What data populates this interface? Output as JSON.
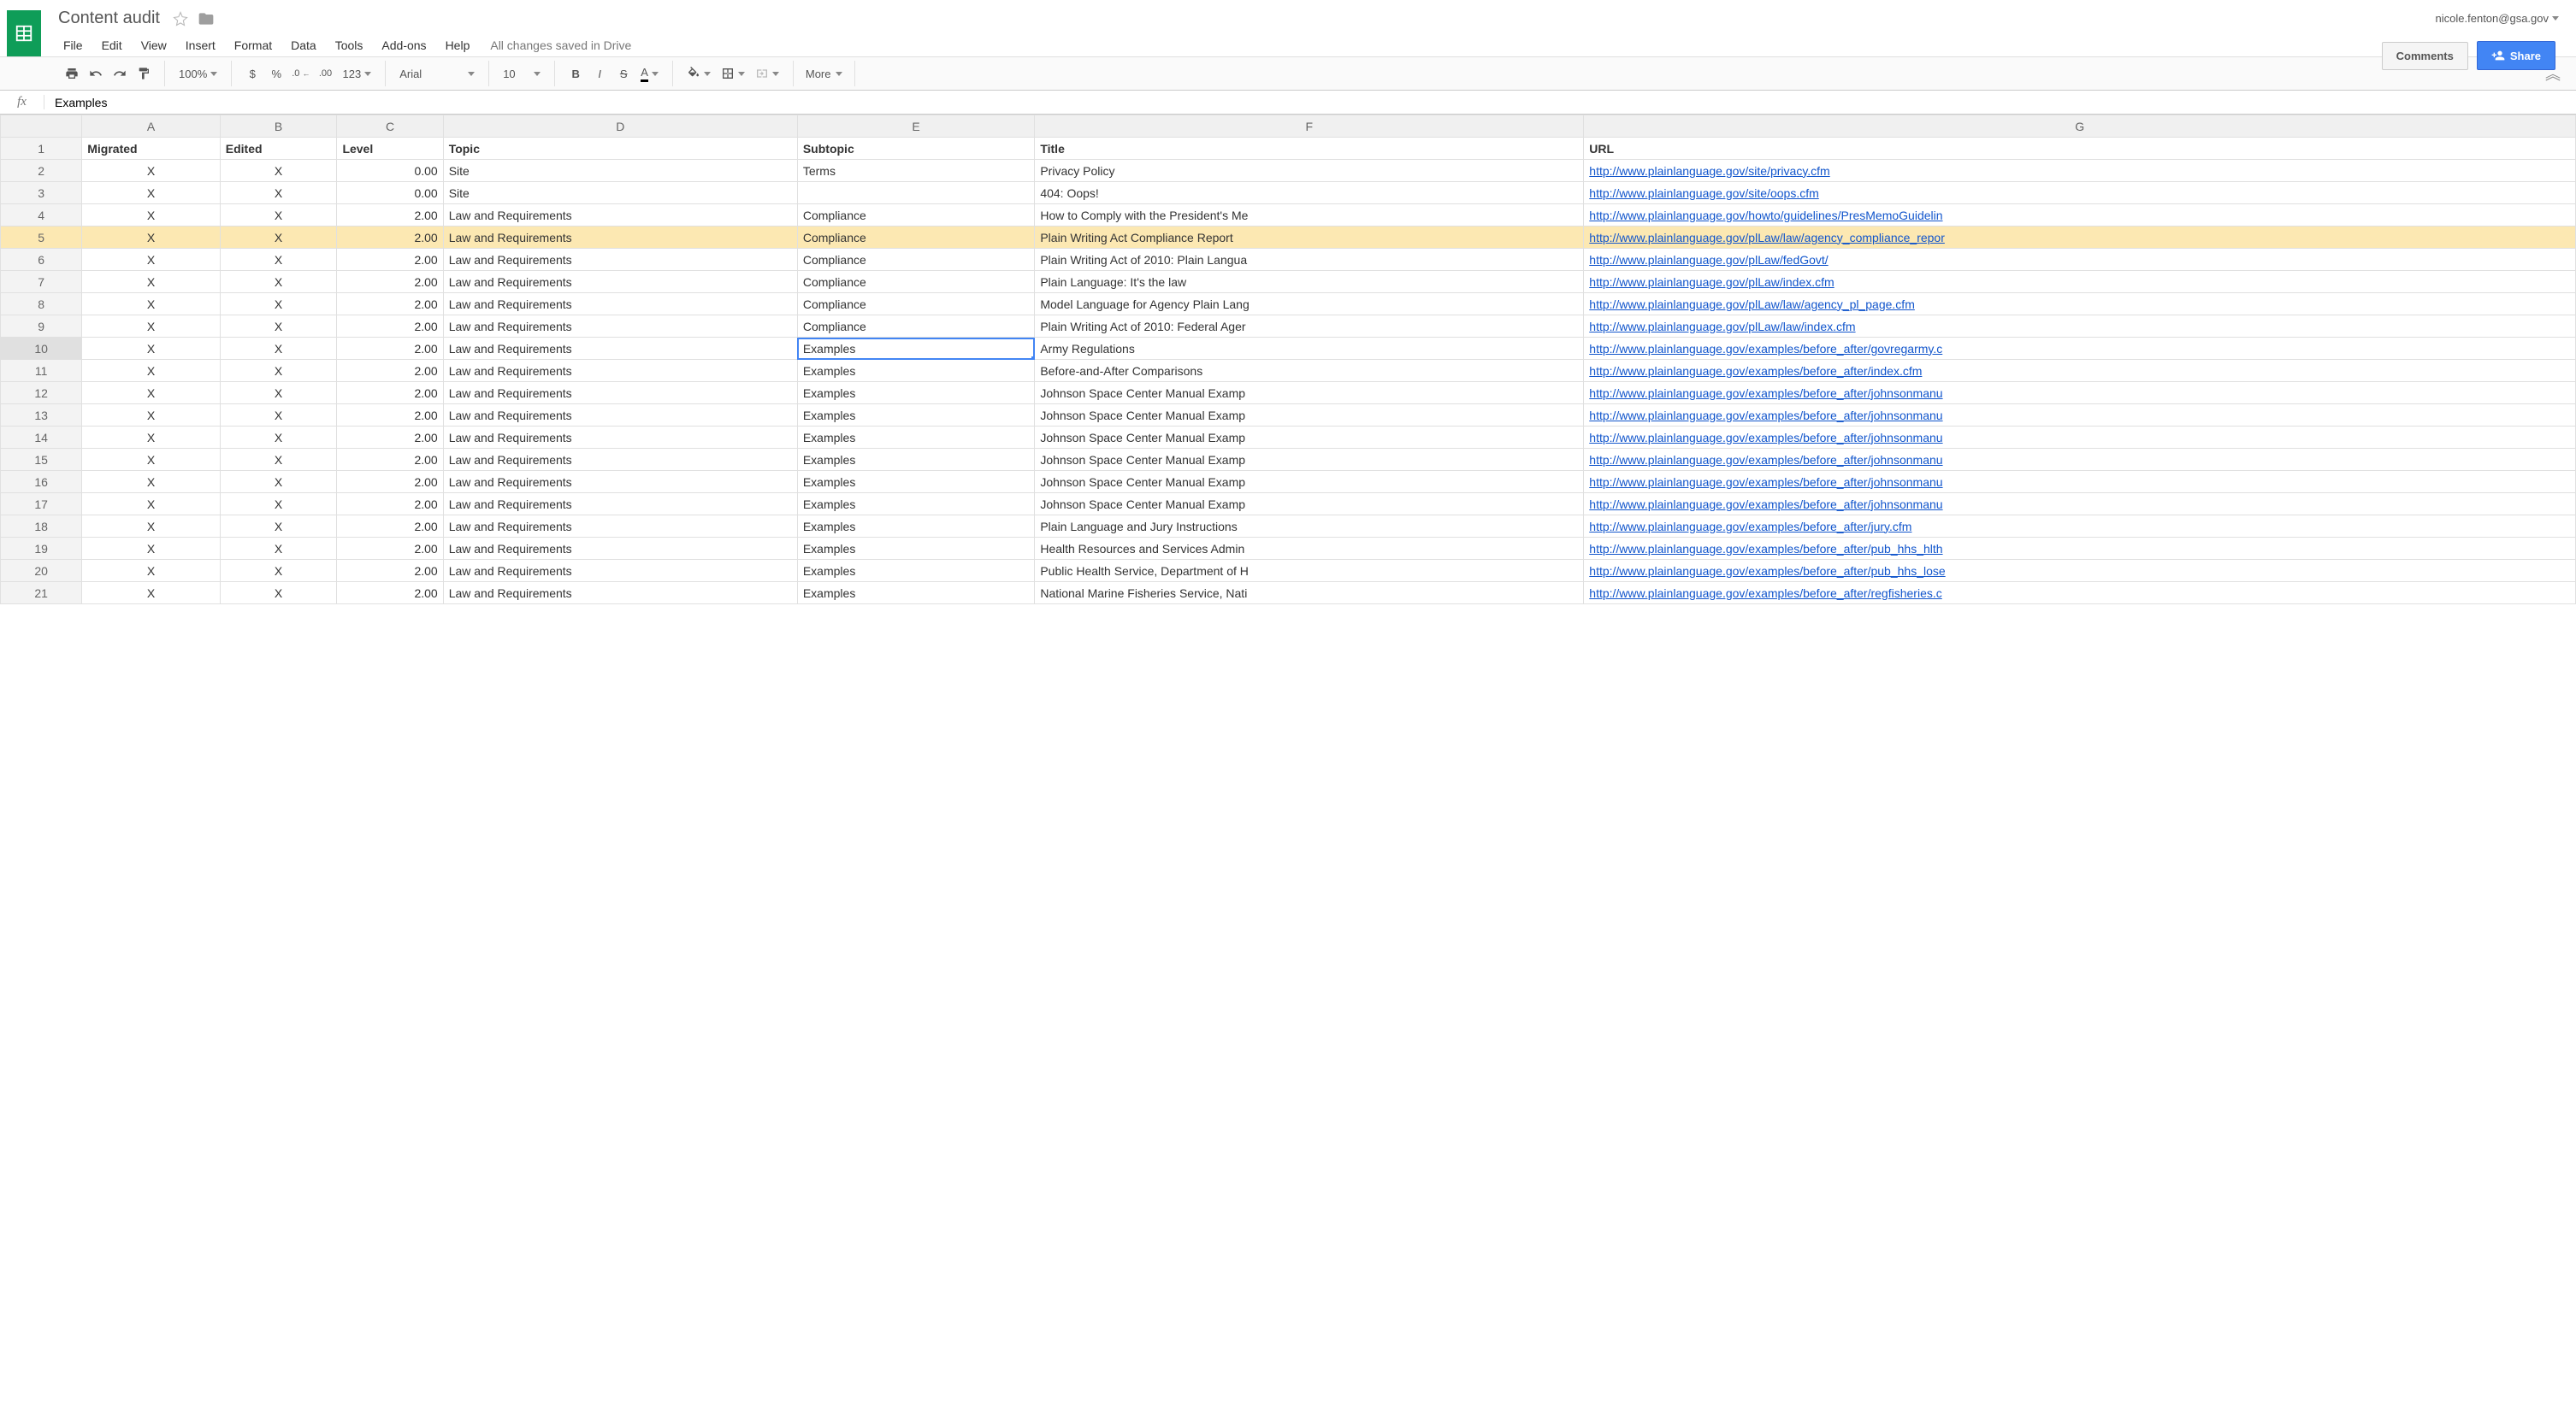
{
  "user_email": "nicole.fenton@gsa.gov",
  "doc_title": "Content audit",
  "save_status": "All changes saved in Drive",
  "menubar": [
    "File",
    "Edit",
    "View",
    "Insert",
    "Format",
    "Data",
    "Tools",
    "Add-ons",
    "Help"
  ],
  "buttons": {
    "comments": "Comments",
    "share": "Share"
  },
  "toolbar": {
    "zoom": "100%",
    "currency": "$",
    "percent": "%",
    "dec_dec": ".0",
    "inc_dec": ".00",
    "numfmt": "123",
    "font": "Arial",
    "font_size": "10",
    "more": "More"
  },
  "formula_cell_value": "Examples",
  "column_letters": [
    "A",
    "B",
    "C",
    "D",
    "E",
    "F",
    "G"
  ],
  "column_headers": [
    "Migrated",
    "Edited",
    "Level",
    "Topic",
    "Subtopic",
    "Title",
    "URL"
  ],
  "selected_cell": {
    "row": 10,
    "col": "E"
  },
  "highlight_row": 5,
  "rows": [
    {
      "n": 2,
      "migrated": "X",
      "edited": "X",
      "level": "0.00",
      "topic": "Site",
      "subtopic": "Terms",
      "title": "Privacy Policy",
      "url": "http://www.plainlanguage.gov/site/privacy.cfm"
    },
    {
      "n": 3,
      "migrated": "X",
      "edited": "X",
      "level": "0.00",
      "topic": "Site",
      "subtopic": "",
      "title": "404: Oops!",
      "url": "http://www.plainlanguage.gov/site/oops.cfm"
    },
    {
      "n": 4,
      "migrated": "X",
      "edited": "X",
      "level": "2.00",
      "topic": "Law and Requirements",
      "subtopic": "Compliance",
      "title": "How to Comply with the President's Me",
      "url": "http://www.plainlanguage.gov/howto/guidelines/PresMemoGuidelin"
    },
    {
      "n": 5,
      "migrated": "X",
      "edited": "X",
      "level": "2.00",
      "topic": "Law and Requirements",
      "subtopic": "Compliance",
      "title": "Plain Writing Act Compliance Report",
      "url": "http://www.plainlanguage.gov/plLaw/law/agency_compliance_repor"
    },
    {
      "n": 6,
      "migrated": "X",
      "edited": "X",
      "level": "2.00",
      "topic": "Law and Requirements",
      "subtopic": "Compliance",
      "title": "Plain Writing Act of 2010: Plain Langua",
      "url": "http://www.plainlanguage.gov/plLaw/fedGovt/"
    },
    {
      "n": 7,
      "migrated": "X",
      "edited": "X",
      "level": "2.00",
      "topic": "Law and Requirements",
      "subtopic": "Compliance",
      "title": "Plain Language: It's the law",
      "url": "http://www.plainlanguage.gov/plLaw/index.cfm"
    },
    {
      "n": 8,
      "migrated": "X",
      "edited": "X",
      "level": "2.00",
      "topic": "Law and Requirements",
      "subtopic": "Compliance",
      "title": "Model Language for Agency Plain Lang",
      "url": "http://www.plainlanguage.gov/plLaw/law/agency_pl_page.cfm"
    },
    {
      "n": 9,
      "migrated": "X",
      "edited": "X",
      "level": "2.00",
      "topic": "Law and Requirements",
      "subtopic": "Compliance",
      "title": "Plain Writing Act of 2010: Federal Ager",
      "url": "http://www.plainlanguage.gov/plLaw/law/index.cfm"
    },
    {
      "n": 10,
      "migrated": "X",
      "edited": "X",
      "level": "2.00",
      "topic": "Law and Requirements",
      "subtopic": "Examples",
      "title": "Army Regulations",
      "url": "http://www.plainlanguage.gov/examples/before_after/govregarmy.c"
    },
    {
      "n": 11,
      "migrated": "X",
      "edited": "X",
      "level": "2.00",
      "topic": "Law and Requirements",
      "subtopic": "Examples",
      "title": "Before-and-After Comparisons",
      "url": "http://www.plainlanguage.gov/examples/before_after/index.cfm"
    },
    {
      "n": 12,
      "migrated": "X",
      "edited": "X",
      "level": "2.00",
      "topic": "Law and Requirements",
      "subtopic": "Examples",
      "title": "Johnson Space Center Manual Examp",
      "url": "http://www.plainlanguage.gov/examples/before_after/johnsonmanu"
    },
    {
      "n": 13,
      "migrated": "X",
      "edited": "X",
      "level": "2.00",
      "topic": "Law and Requirements",
      "subtopic": "Examples",
      "title": "Johnson Space Center Manual Examp",
      "url": "http://www.plainlanguage.gov/examples/before_after/johnsonmanu"
    },
    {
      "n": 14,
      "migrated": "X",
      "edited": "X",
      "level": "2.00",
      "topic": "Law and Requirements",
      "subtopic": "Examples",
      "title": "Johnson Space Center Manual Examp",
      "url": "http://www.plainlanguage.gov/examples/before_after/johnsonmanu"
    },
    {
      "n": 15,
      "migrated": "X",
      "edited": "X",
      "level": "2.00",
      "topic": "Law and Requirements",
      "subtopic": "Examples",
      "title": "Johnson Space Center Manual Examp",
      "url": "http://www.plainlanguage.gov/examples/before_after/johnsonmanu"
    },
    {
      "n": 16,
      "migrated": "X",
      "edited": "X",
      "level": "2.00",
      "topic": "Law and Requirements",
      "subtopic": "Examples",
      "title": "Johnson Space Center Manual Examp",
      "url": "http://www.plainlanguage.gov/examples/before_after/johnsonmanu"
    },
    {
      "n": 17,
      "migrated": "X",
      "edited": "X",
      "level": "2.00",
      "topic": "Law and Requirements",
      "subtopic": "Examples",
      "title": "Johnson Space Center Manual Examp",
      "url": "http://www.plainlanguage.gov/examples/before_after/johnsonmanu"
    },
    {
      "n": 18,
      "migrated": "X",
      "edited": "X",
      "level": "2.00",
      "topic": "Law and Requirements",
      "subtopic": "Examples",
      "title": "Plain Language and Jury Instructions",
      "url": "http://www.plainlanguage.gov/examples/before_after/jury.cfm"
    },
    {
      "n": 19,
      "migrated": "X",
      "edited": "X",
      "level": "2.00",
      "topic": "Law and Requirements",
      "subtopic": "Examples",
      "title": "Health Resources and Services Admin",
      "url": "http://www.plainlanguage.gov/examples/before_after/pub_hhs_hlth"
    },
    {
      "n": 20,
      "migrated": "X",
      "edited": "X",
      "level": "2.00",
      "topic": "Law and Requirements",
      "subtopic": "Examples",
      "title": "Public Health Service, Department of H",
      "url": "http://www.plainlanguage.gov/examples/before_after/pub_hhs_lose"
    },
    {
      "n": 21,
      "migrated": "X",
      "edited": "X",
      "level": "2.00",
      "topic": "Law and Requirements",
      "subtopic": "Examples",
      "title": "National Marine Fisheries Service, Nati",
      "url": "http://www.plainlanguage.gov/examples/before_after/regfisheries.c"
    }
  ]
}
